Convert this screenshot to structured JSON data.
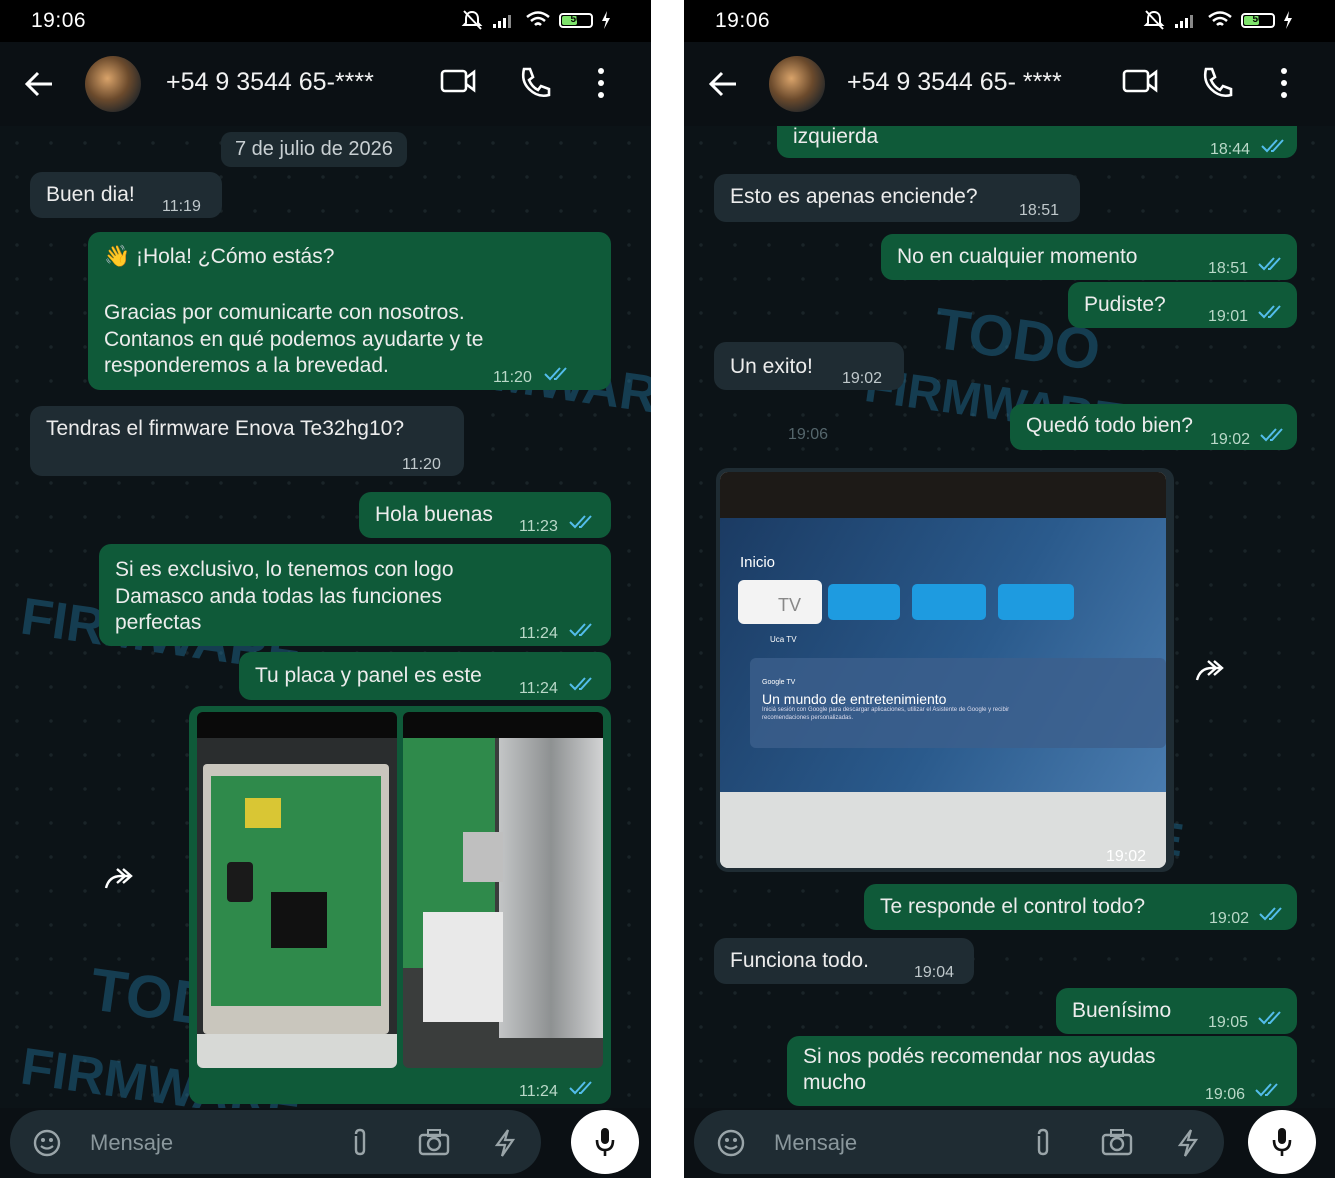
{
  "status_bar": {
    "time": "19:06",
    "battery": "50"
  },
  "left_screen": {
    "contact": "+54 9 3544 65-****",
    "date_chip": "7 de julio de 2026",
    "messages": [
      {
        "dir": "in",
        "text": "Buen dia!",
        "time": "11:19"
      },
      {
        "dir": "out",
        "line1": "👋 ¡Hola! ¿Cómo estás?",
        "line2": "Gracias por comunicarte con nosotros.",
        "line3": "Contanos en qué podemos ayudarte y te",
        "line4": "responderemos a la brevedad.",
        "time": "11:20"
      },
      {
        "dir": "in",
        "text": "Tendras el firmware Enova Te32hg10?",
        "time": "11:20"
      },
      {
        "dir": "out",
        "text": "Hola buenas",
        "time": "11:23"
      },
      {
        "dir": "out",
        "line1": "Si es exclusivo, lo tenemos con logo",
        "line2": "Damasco anda todas las funciones",
        "line3": "perfectas",
        "time": "11:24"
      },
      {
        "dir": "out",
        "text": "Tu placa y panel es este",
        "time": "11:24"
      },
      {
        "dir": "out",
        "type": "images",
        "time": "11:24"
      }
    ],
    "composer_placeholder": "Mensaje"
  },
  "right_screen": {
    "contact": "+54 9 3544 65- ****",
    "messages": [
      {
        "dir": "out",
        "text": "izquierda",
        "time": "18:44"
      },
      {
        "dir": "in",
        "text": "Esto es apenas enciende?",
        "time": "18:51"
      },
      {
        "dir": "out",
        "text": "No en cualquier momento",
        "time": "18:51"
      },
      {
        "dir": "out",
        "text": "Pudiste?",
        "time": "19:01"
      },
      {
        "dir": "in",
        "text": "Un exito!",
        "time": "19:02"
      },
      {
        "dir": "out",
        "text": "Quedó todo bien?",
        "time": "19:02"
      },
      {
        "dir": "in",
        "type": "image",
        "time": "19:02",
        "pending_time": "19:06",
        "screen": {
          "home": "Inicio",
          "tv_tile": "TV",
          "tv_sub": "Uca TV",
          "brand": "Google TV",
          "headline": "Un mundo de entretenimiento",
          "body": "Iniciá sesión con Google para descargar aplicaciones, utilizar el Asistente de Google y recibir recomendaciones personalizadas."
        }
      },
      {
        "dir": "out",
        "text": "Te responde el control todo?",
        "time": "19:02"
      },
      {
        "dir": "in",
        "text": "Funciona todo.",
        "time": "19:04"
      },
      {
        "dir": "out",
        "text": "Buenísimo",
        "time": "19:05"
      },
      {
        "dir": "out",
        "line1": "Si nos podés recomendar nos ayudas",
        "line2": "mucho",
        "time": "19:06"
      }
    ],
    "composer_placeholder": "Mensaje"
  },
  "watermark": {
    "brand": "TODO",
    "sub": "FIRMWARE"
  },
  "colors": {
    "outgoing": "#0f5a39",
    "incoming": "#1f2c33",
    "tick_read": "#53bdeb",
    "background": "#0c1317"
  },
  "icons": [
    "back-arrow-icon",
    "video-call-icon",
    "phone-call-icon",
    "more-vert-icon",
    "emoji-icon",
    "attach-icon",
    "camera-icon",
    "bolt-icon",
    "mic-icon",
    "forward-icon",
    "double-tick-icon",
    "mute-icon",
    "signal-icon",
    "wifi-icon",
    "battery-icon",
    "charging-icon"
  ]
}
